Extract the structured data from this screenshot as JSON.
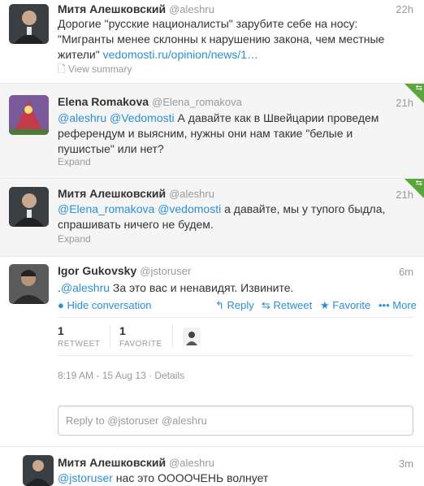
{
  "tweets": [
    {
      "name": "Митя Алешковский",
      "handle": "@aleshru",
      "time": "22h",
      "text_1": "Дорогие \"русские националисты\" зарубите себе на носу: \"Мигранты менее склонны к нарушению закона, чем местные жители\" ",
      "link": "vedomosti.ru/opinion/news/1…",
      "action": "View summary"
    },
    {
      "name": "Elena Romakova",
      "handle": "@Elena_romakova",
      "time": "21h",
      "mention1": "@aleshru",
      "mention2": "@Vedomosti",
      "text": " А давайте как в Швейцарии проведем референдум и выясним, нужны они нам такие \"белые и пушистые\" или нет?",
      "expand": "Expand"
    },
    {
      "name": "Митя Алешковский",
      "handle": "@aleshru",
      "time": "21h",
      "mention1": "@Elena_romakova",
      "mention2": "@vedomosti",
      "text": " а давайте, мы у тупого быдла, спрашивать ничего не будем.",
      "expand": "Expand"
    },
    {
      "name": "Igor Gukovsky",
      "handle": "@jstoruser",
      "time": "6m",
      "prefix": ".",
      "mention1": "@aleshru",
      "text": " За это вас и ненавидят. Извините.",
      "hide": "Hide conversation",
      "reply": "Reply",
      "retweet": "Retweet",
      "favorite": "Favorite",
      "more": "More",
      "retweets_count": "1",
      "retweets_label": "RETWEET",
      "favorites_count": "1",
      "favorites_label": "FAVORITE",
      "timestamp": "8:19 AM - 15 Aug 13",
      "details": "Details",
      "reply_placeholder": "Reply to @jstoruser @aleshru"
    },
    {
      "name": "Митя Алешковский",
      "handle": "@aleshru",
      "time": "3m",
      "mention1": "@jstoruser",
      "text": " нас это ООООЧЕНЬ волнует"
    }
  ],
  "colors": {
    "link": "#2a8fd6",
    "retweeted_corner": "#5ba63a"
  }
}
